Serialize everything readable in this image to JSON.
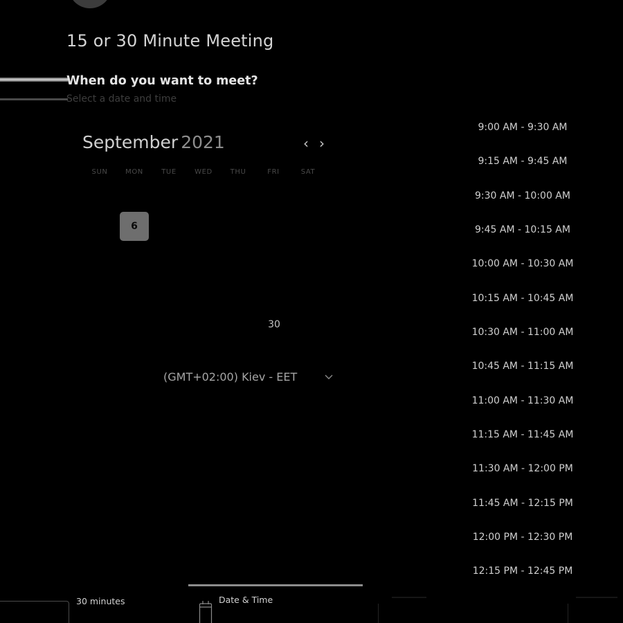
{
  "meeting": {
    "title": "15 or 30 Minute Meeting",
    "question": "When do you want to meet?",
    "hint": "Select a date and time"
  },
  "calendar": {
    "month": "September",
    "year": "2021",
    "prev_icon": "chevron-left-icon",
    "next_icon": "chevron-right-icon",
    "weekdays": [
      "SUN",
      "MON",
      "TUE",
      "WED",
      "THU",
      "FRI",
      "SAT"
    ],
    "selected_day": "6",
    "available_day": "30"
  },
  "timezone": {
    "label": "(GMT+02:00) Kiev - EET",
    "icon": "chevron-down-icon"
  },
  "slots": [
    "9:00 AM - 9:30 AM",
    "9:15 AM - 9:45 AM",
    "9:30 AM - 10:00 AM",
    "9:45 AM - 10:15 AM",
    "10:00 AM - 10:30 AM",
    "10:15 AM - 10:45 AM",
    "10:30 AM - 11:00 AM",
    "10:45 AM - 11:15 AM",
    "11:00 AM - 11:30 AM",
    "11:15 AM - 11:45 AM",
    "11:30 AM - 12:00 PM",
    "11:45 AM - 12:15 PM",
    "12:00 PM - 12:30 PM",
    "12:15 PM - 12:45 PM"
  ],
  "steps": {
    "duration": "30 minutes",
    "date_time": "Date & Time",
    "date_time_icon": "calendar-icon"
  },
  "colors": {
    "background": "#000000",
    "selected_day": "#6e6e6e",
    "tab_indicator": "#8c8c8c"
  }
}
